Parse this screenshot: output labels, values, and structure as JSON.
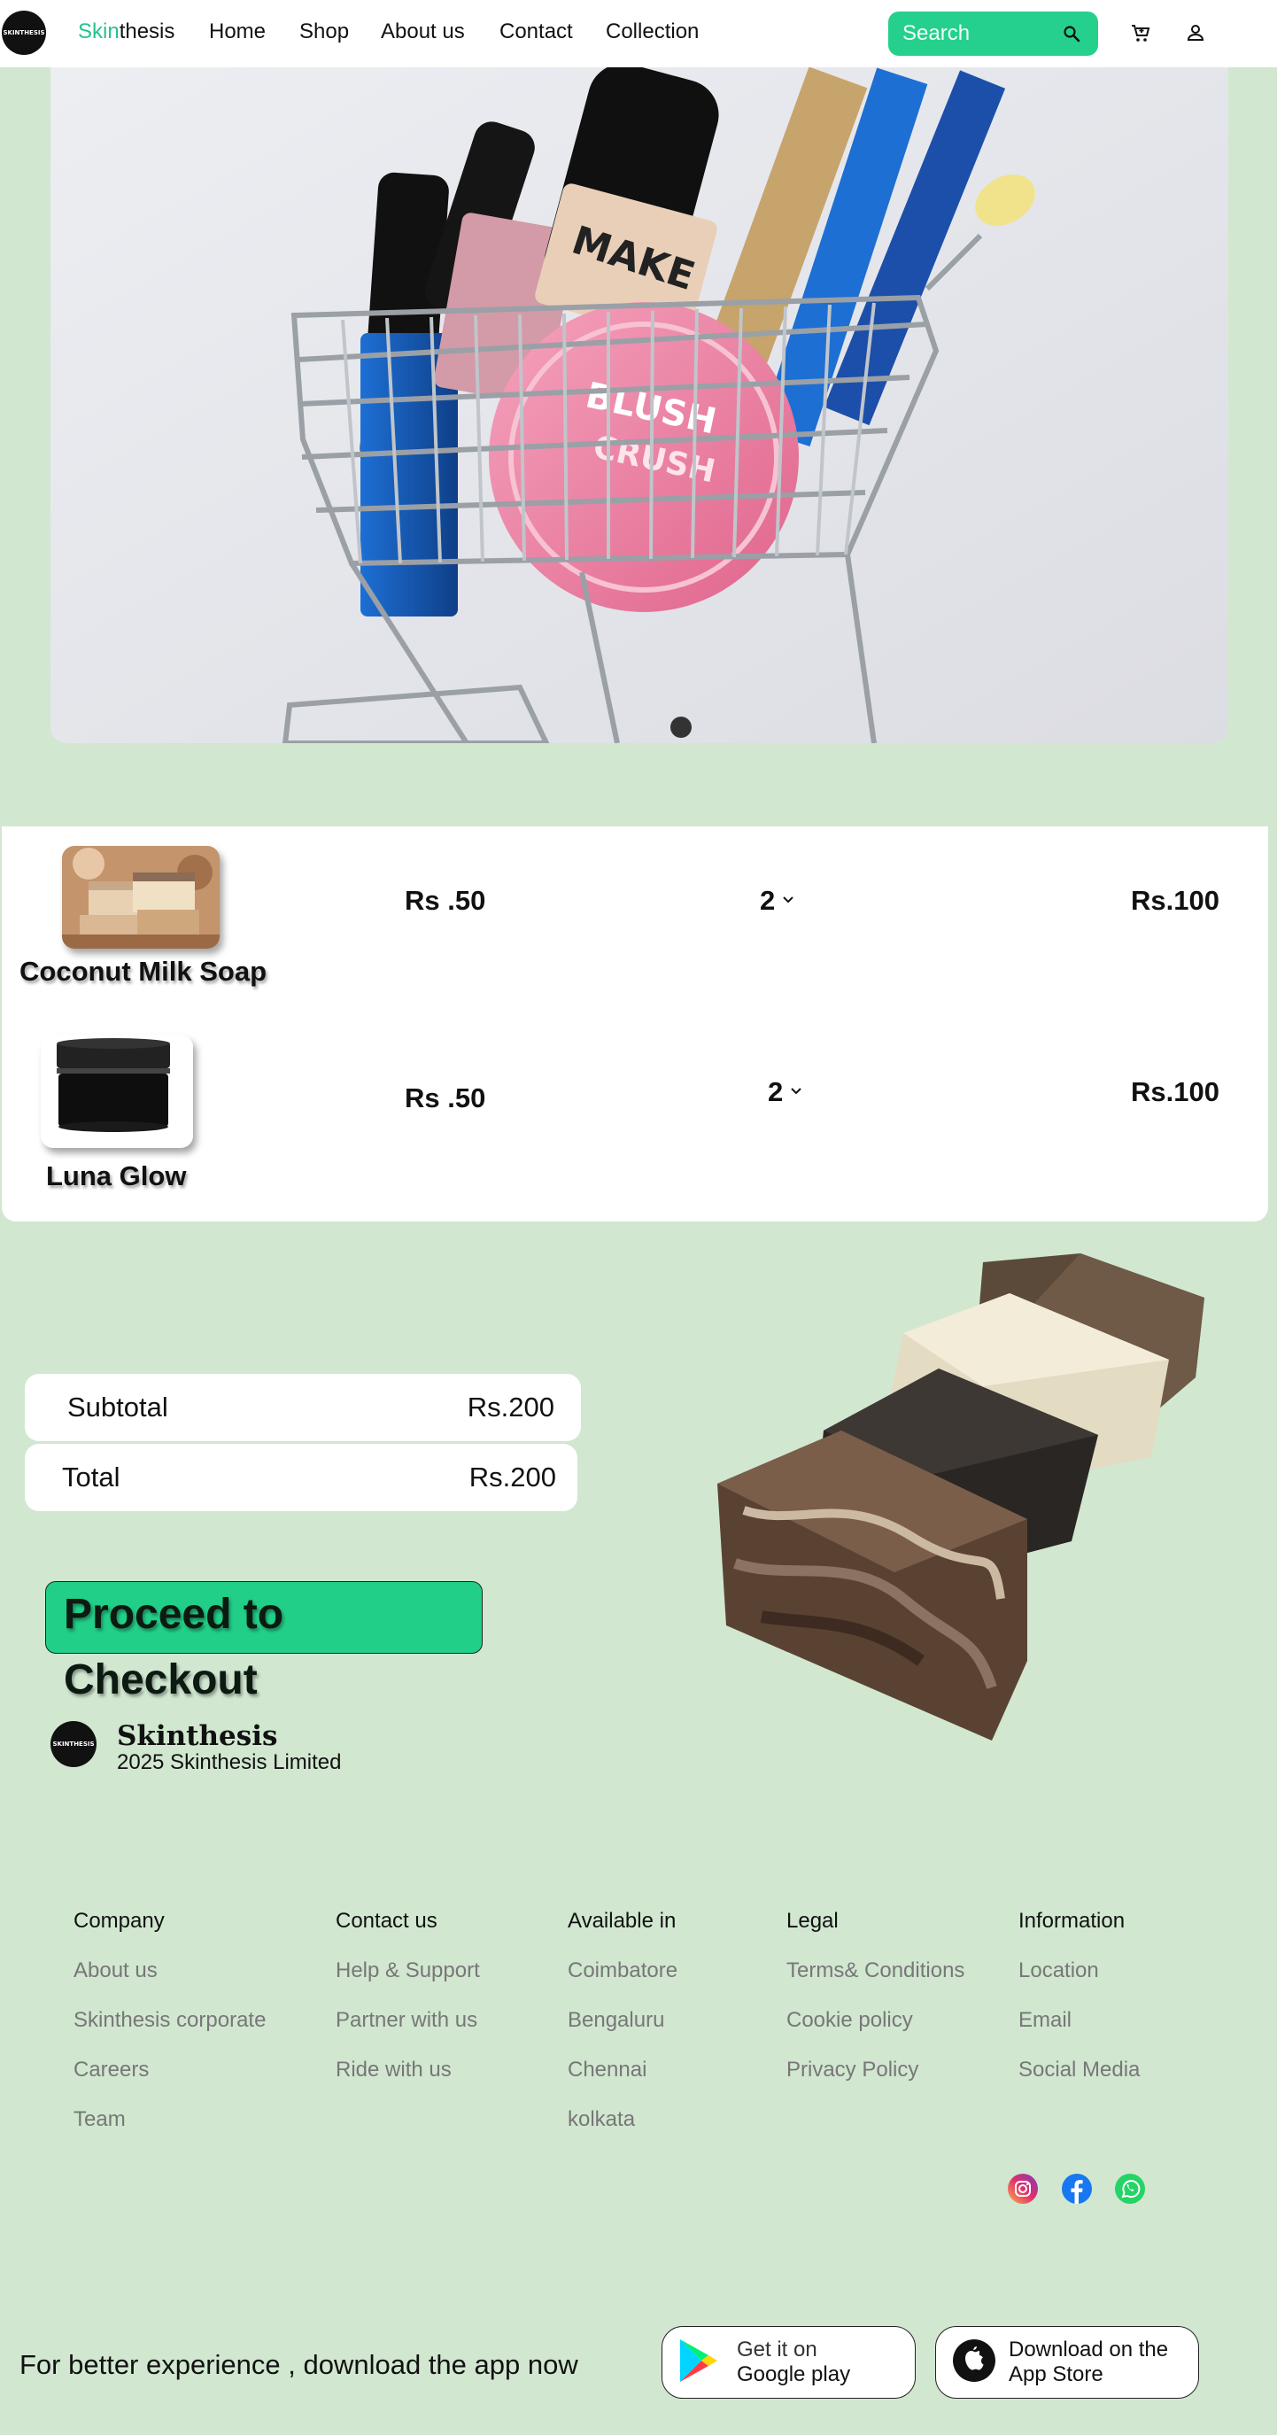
{
  "nav": {
    "logo_text": "SKINTHESIS",
    "brand_accent": "Skin",
    "brand_rest": "thesis",
    "links": [
      "Home",
      "Shop",
      "About us",
      "Contact",
      "Collection"
    ],
    "search_placeholder": "Search"
  },
  "cart": {
    "items": [
      {
        "name": "Coconut Milk Soap",
        "price": "Rs .50",
        "qty": "2",
        "total": "Rs.100"
      },
      {
        "name": "Luna Glow",
        "price": "Rs .50",
        "qty": "2",
        "total": "Rs.100"
      }
    ]
  },
  "summary": {
    "subtotal_label": "Subtotal",
    "subtotal_value": "Rs.200",
    "total_label": "Total",
    "total_value": "Rs.200",
    "checkout_label": "Proceed to Checkout"
  },
  "footer": {
    "brand": "Skinthesis",
    "copyright": "2025 Skinthesis Limited",
    "columns": [
      {
        "title": "Company",
        "links": [
          "About us",
          "Skinthesis corporate",
          "Careers",
          "Team"
        ]
      },
      {
        "title": "Contact us",
        "links": [
          "Help & Support",
          "Partner with us",
          "Ride with us"
        ]
      },
      {
        "title": "Available in",
        "links": [
          "Coimbatore",
          "Bengaluru",
          "Chennai",
          "kolkata"
        ]
      },
      {
        "title": "Legal",
        "links": [
          "Terms& Conditions",
          "Cookie policy",
          "Privacy Policy"
        ]
      },
      {
        "title": "Information",
        "links": [
          "Location",
          "Email",
          "Social Media"
        ]
      }
    ],
    "social_icons": [
      "instagram-icon",
      "facebook-icon",
      "whatsapp-icon"
    ],
    "download_text": "For better experience , download the app now",
    "google_small": "Get it on",
    "google_big": "Google play",
    "apple_small": "Download on the",
    "apple_big": "App Store"
  },
  "colors": {
    "page_bg": "#d1e7d0",
    "accent": "#22c58a",
    "search_bg": "#25d08d",
    "checkout_bg": "#22cf88"
  }
}
